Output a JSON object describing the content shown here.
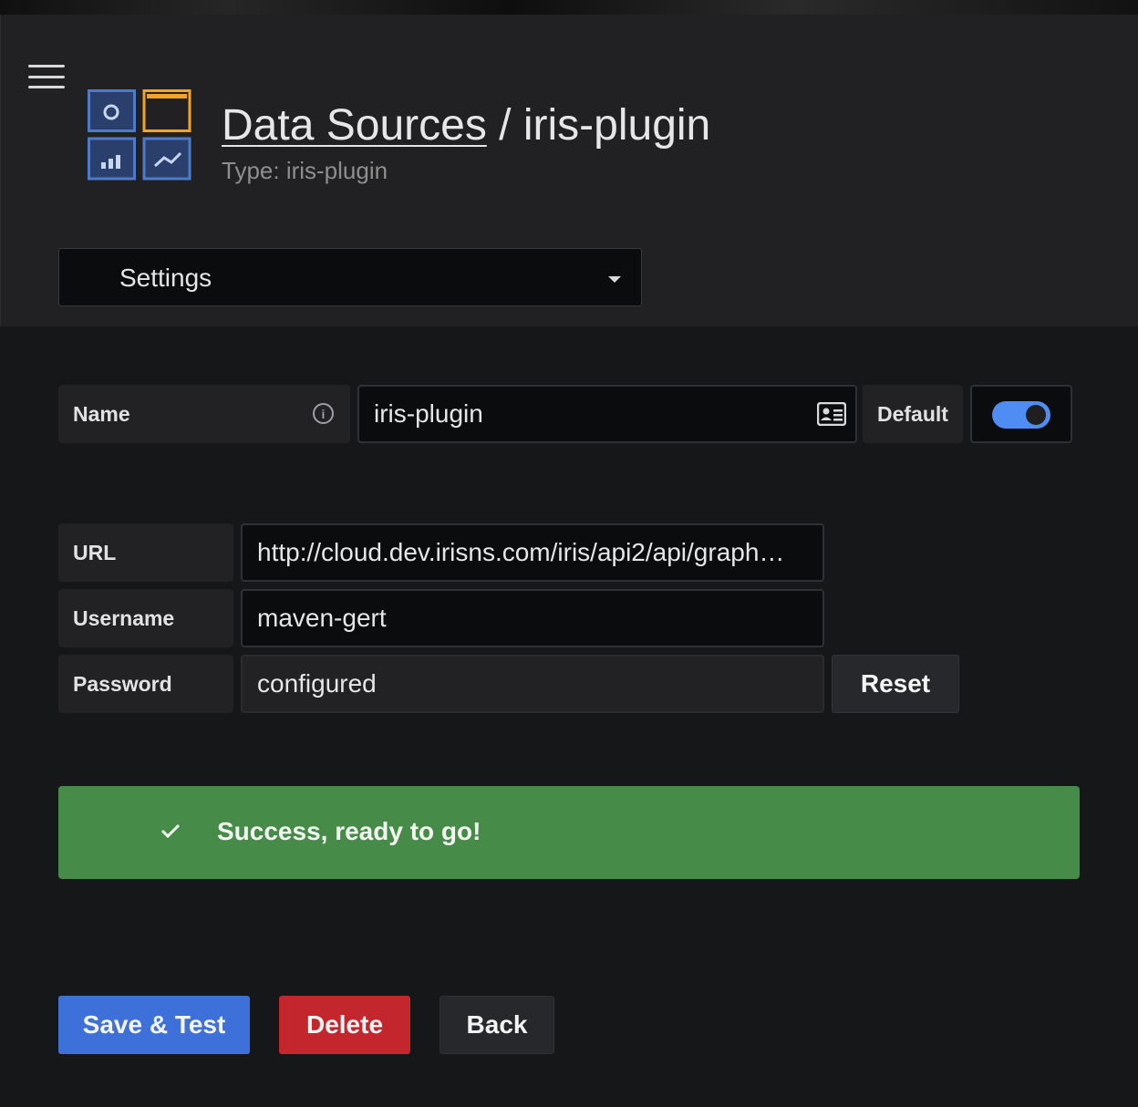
{
  "header": {
    "breadcrumb_link": "Data Sources",
    "separator": "/",
    "page_name": "iris-plugin",
    "subtitle": "Type: iris-plugin"
  },
  "tabs": {
    "selected": "Settings"
  },
  "fields": {
    "name": {
      "label": "Name",
      "value": "iris-plugin"
    },
    "default": {
      "label": "Default",
      "enabled": true
    },
    "url": {
      "label": "URL",
      "value": "http://cloud.dev.irisns.com/iris/api2/api/graph…"
    },
    "username": {
      "label": "Username",
      "value": "maven-gert"
    },
    "password": {
      "label": "Password",
      "value": "configured",
      "reset_label": "Reset"
    }
  },
  "alert": {
    "message": "Success, ready to go!",
    "status_color": "#468b47"
  },
  "actions": {
    "save_test": "Save & Test",
    "delete": "Delete",
    "back": "Back"
  },
  "colors": {
    "primary": "#3d71d9",
    "danger": "#c4262e",
    "secondary": "#27282b",
    "toggle_on": "#4f8cf4"
  },
  "icons": {
    "menu": "hamburger-icon",
    "logo": "datasources-logo-icon",
    "tooltip": "info-icon",
    "name_card": "id-card-icon",
    "dropdown": "caret-down-icon",
    "success": "check-icon"
  }
}
